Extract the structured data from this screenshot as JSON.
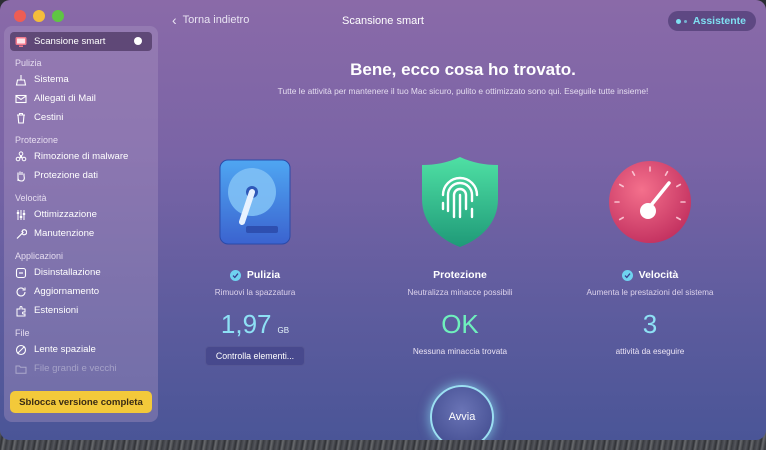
{
  "window": {
    "title": "Scansione smart",
    "back_label": "Torna indietro",
    "assistant_label": "Assistente"
  },
  "sidebar": {
    "selected": {
      "label": "Scansione smart",
      "icon": "monitor-icon"
    },
    "sections": [
      {
        "title": "Pulizia",
        "items": [
          {
            "label": "Sistema",
            "icon": "broom-icon"
          },
          {
            "label": "Allegati di Mail",
            "icon": "mail-icon"
          },
          {
            "label": "Cestini",
            "icon": "trash-icon"
          }
        ]
      },
      {
        "title": "Protezione",
        "items": [
          {
            "label": "Rimozione di malware",
            "icon": "biohazard-icon"
          },
          {
            "label": "Protezione dati",
            "icon": "hand-icon"
          }
        ]
      },
      {
        "title": "Velocità",
        "items": [
          {
            "label": "Ottimizzazione",
            "icon": "sliders-icon"
          },
          {
            "label": "Manutenzione",
            "icon": "wrench-icon"
          }
        ]
      },
      {
        "title": "Applicazioni",
        "items": [
          {
            "label": "Disinstallazione",
            "icon": "uninstall-icon"
          },
          {
            "label": "Aggiornamento",
            "icon": "update-icon"
          },
          {
            "label": "Estensioni",
            "icon": "extension-icon"
          }
        ]
      },
      {
        "title": "File",
        "items": [
          {
            "label": "Lente spaziale",
            "icon": "lens-icon"
          },
          {
            "label": "File grandi e vecchi",
            "icon": "folder-icon"
          }
        ]
      }
    ],
    "unlock_label": "Sblocca versione completa"
  },
  "main": {
    "headline": "Bene, ecco cosa ho trovato.",
    "subline": "Tutte le attività per mantenere il tuo Mac sicuro, pulito e ottimizzato sono qui. Eseguile tutte insieme!",
    "columns": [
      {
        "title": "Pulizia",
        "description": "Rimuovi la spazzatura",
        "value": "1,97",
        "unit": "GB",
        "action_label": "Controlla elementi...",
        "icon": "hard-drive-icon",
        "checked": true
      },
      {
        "title": "Protezione",
        "description": "Neutralizza minacce possibili",
        "value": "OK",
        "sub": "Nessuna minaccia trovata",
        "icon": "fingerprint-shield-icon",
        "checked": false
      },
      {
        "title": "Velocità",
        "description": "Aumenta le prestazioni del sistema",
        "value": "3",
        "sub": "attività da eseguire",
        "icon": "speedometer-icon",
        "checked": true
      }
    ],
    "run_label": "Avvia"
  },
  "colors": {
    "accent_cyan": "#8ee1f5",
    "ok_green": "#6ff0bd",
    "unlock_yellow": "#f3c93a"
  }
}
